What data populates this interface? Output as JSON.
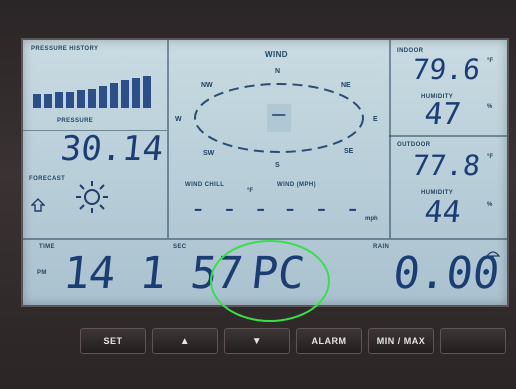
{
  "pressure": {
    "history_label": "PRESSURE HISTORY",
    "reading_label": "PRESSURE",
    "value": "30.14",
    "forecast_label": "FORECAST",
    "forecast_icon": "sun-icon"
  },
  "wind": {
    "title": "WIND",
    "directions": {
      "n": "N",
      "ne": "NE",
      "e": "E",
      "se": "SE",
      "s": "S",
      "sw": "SW",
      "w": "W",
      "nw": "NW"
    },
    "center_value": "–",
    "wind_chill_label": "WIND CHILL",
    "wind_chill_value": "- - -",
    "wind_speed_label": "WIND (MPH)",
    "wind_speed_value": "- - -",
    "speed_unit": "mph"
  },
  "indoor": {
    "label": "INDOOR",
    "temp": "79.6",
    "temp_unit": "°F",
    "humidity_label": "HUMIDITY",
    "humidity": "47",
    "humidity_unit": "%"
  },
  "outdoor": {
    "label": "OUTDOOR",
    "temp": "77.8",
    "temp_unit": "°F",
    "humidity_label": "HUMIDITY",
    "humidity": "44",
    "humidity_unit": "%"
  },
  "bottom": {
    "time_label": "TIME",
    "sec_label": "SEC",
    "am_pm": "PM",
    "time": "14 1 57",
    "mode": "PC",
    "rain_label": "RAIN",
    "rain": "0.00"
  },
  "buttons": {
    "set": "SET",
    "up": "▲",
    "down": "▼",
    "alarm": "ALARM",
    "minmax": "MIN / MAX"
  },
  "colors": {
    "lcd": "#c3d6df",
    "digits": "#1b3d73",
    "highlight": "#37e04a"
  }
}
